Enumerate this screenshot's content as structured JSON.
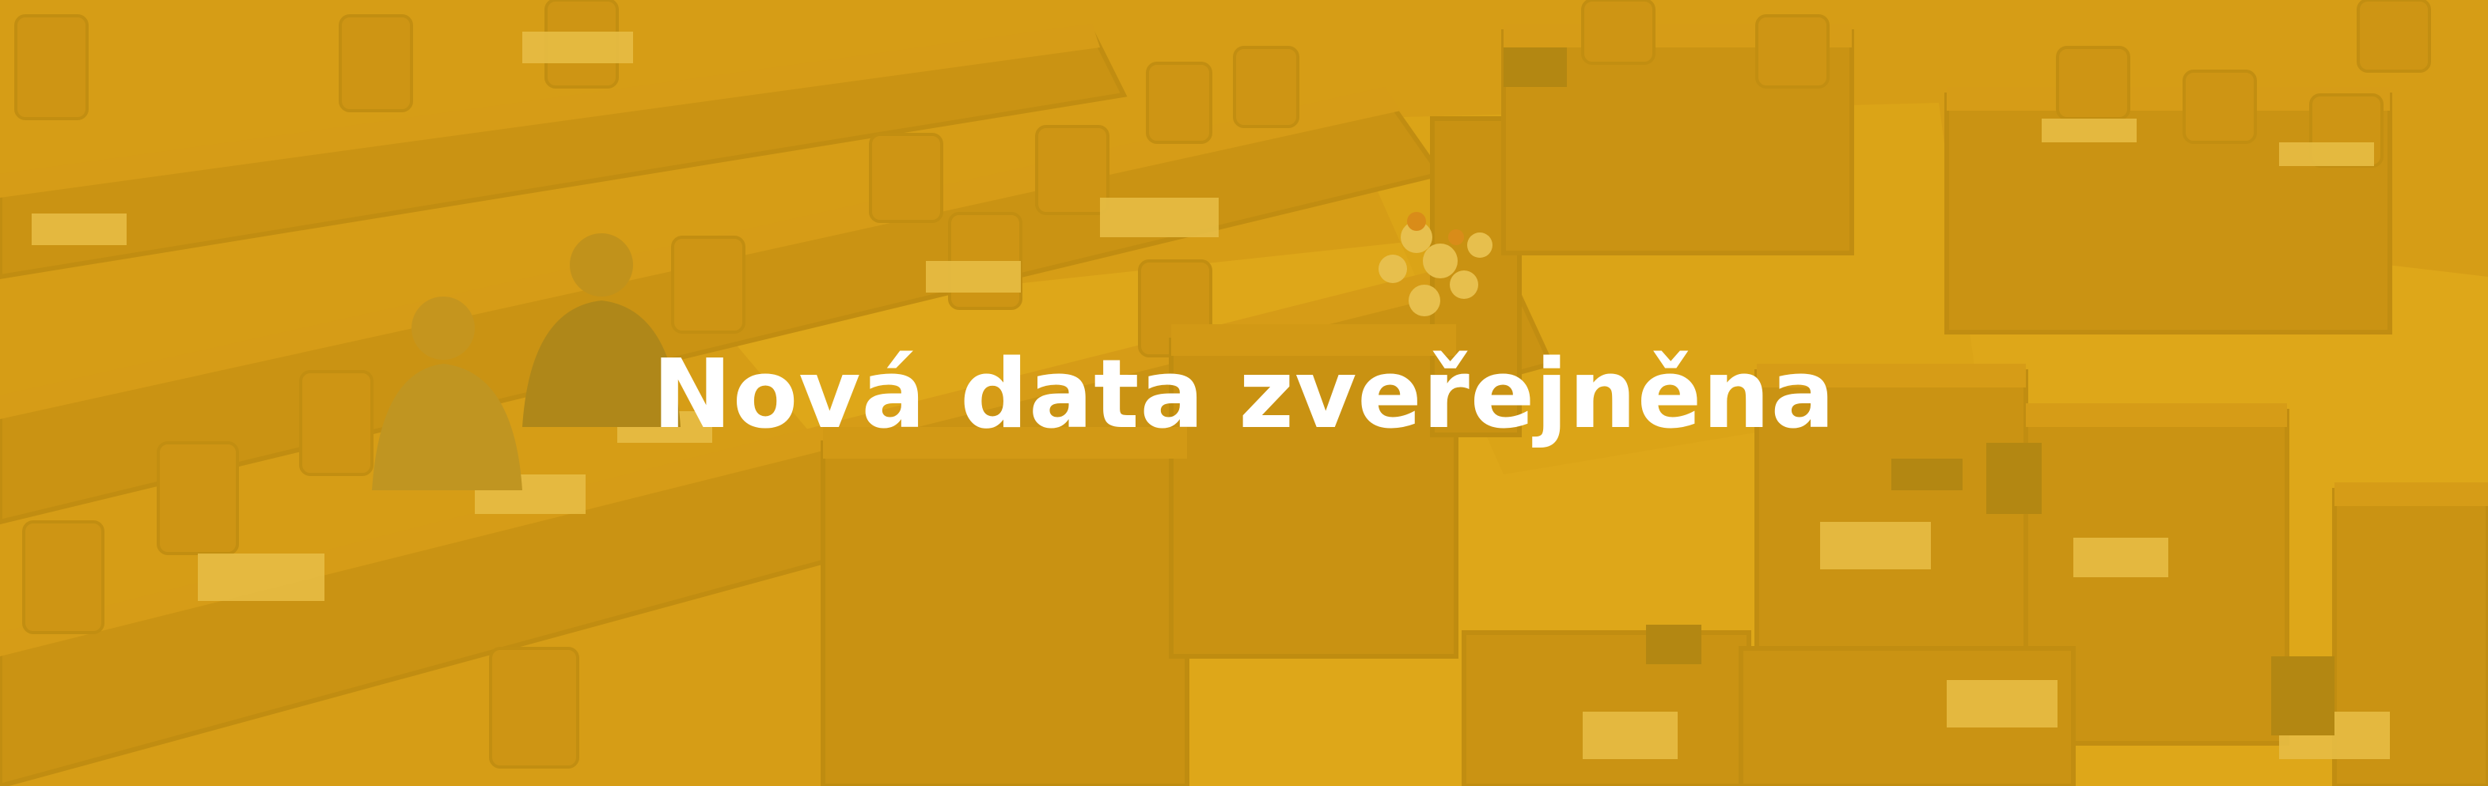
{
  "banner": {
    "headline": "Nová data zveřejněna",
    "background_image": "parliament-chamber-photo",
    "overlay_color": "#e2ac14",
    "text_color": "#ffffff"
  }
}
